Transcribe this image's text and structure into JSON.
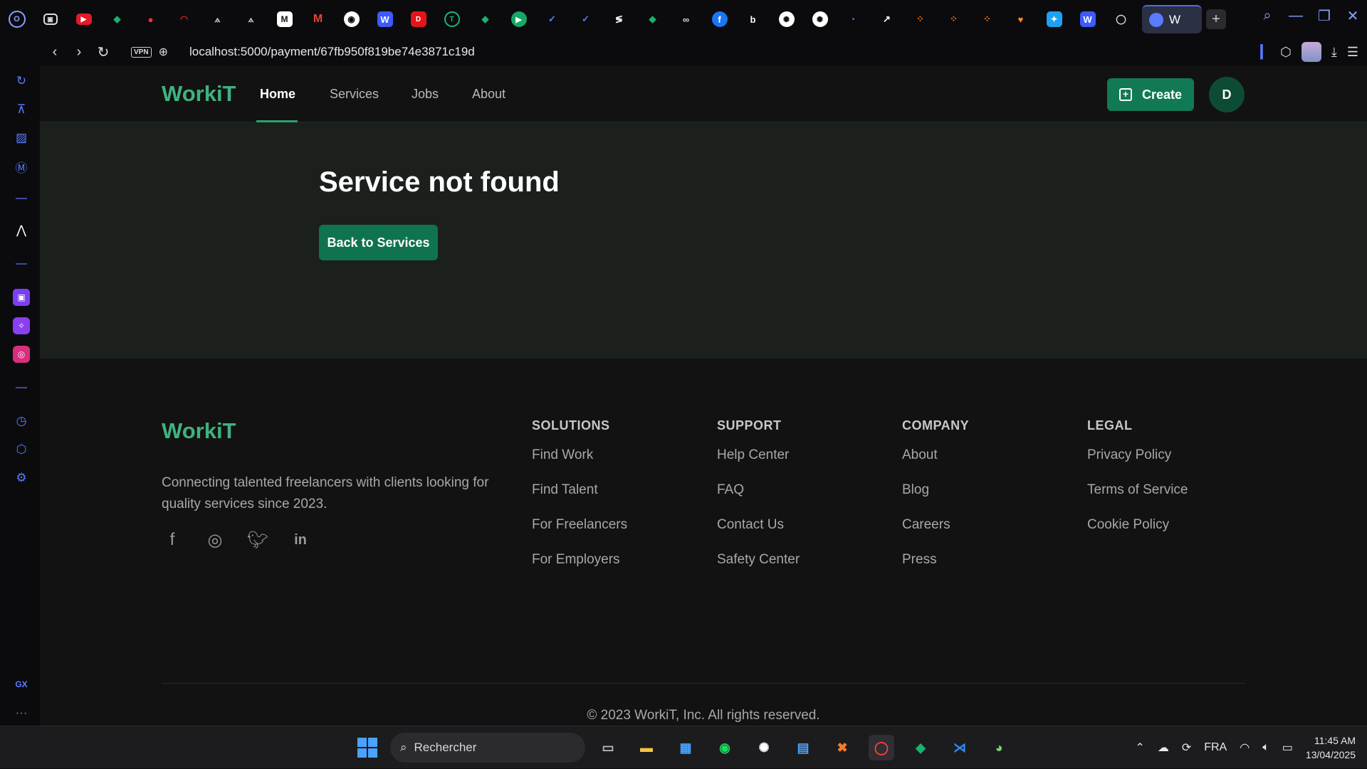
{
  "browser": {
    "tabs_icons": [
      "youtube",
      "mongodb",
      "red-app",
      "speed",
      "network",
      "network",
      "mastodon",
      "gmail",
      "github",
      "word",
      "dribbble",
      "ticktick",
      "mongodb",
      "arrow-app",
      "vk",
      "vk",
      "stack",
      "mongodb",
      "ring",
      "facebook",
      "bold",
      "chatgpt",
      "chatgpt",
      "dot",
      "arrow",
      "grid",
      "grid",
      "grid",
      "heart",
      "bluesky",
      "word",
      "circle"
    ],
    "active_tab_label": "W",
    "new_tab_label": "+",
    "url_host": "localhost",
    "url_rest": ":5000/payment/67fb950f819be74e3871c19d",
    "vpn_label": "VPN"
  },
  "site": {
    "brand": "WorkiT",
    "nav": [
      "Home",
      "Services",
      "Jobs",
      "About"
    ],
    "create_label": "Create",
    "avatar_initial": "D"
  },
  "hero": {
    "title": "Service not found",
    "back_button": "Back to Services"
  },
  "footer": {
    "brand": "WorkiT",
    "tagline": "Connecting talented freelancers with clients looking for quality services since 2023.",
    "social": [
      "facebook-icon",
      "instagram-icon",
      "twitter-icon",
      "linkedin-icon"
    ],
    "columns": [
      {
        "title": "SOLUTIONS",
        "links": [
          "Find Work",
          "Find Talent",
          "For Freelancers",
          "For Employers"
        ]
      },
      {
        "title": "SUPPORT",
        "links": [
          "Help Center",
          "FAQ",
          "Contact Us",
          "Safety Center"
        ]
      },
      {
        "title": "COMPANY",
        "links": [
          "About",
          "Blog",
          "Careers",
          "Press"
        ]
      },
      {
        "title": "LEGAL",
        "links": [
          "Privacy Policy",
          "Terms of Service",
          "Cookie Policy"
        ]
      }
    ],
    "copyright": "© 2023 WorkiT, Inc. All rights reserved."
  },
  "sidebar": {
    "gx_label": "GX",
    "more_label": "···"
  },
  "taskbar": {
    "search_placeholder": "Rechercher",
    "language": "FRA",
    "time": "11:45 AM",
    "date": "13/04/2025"
  },
  "colors": {
    "brand_green": "#3fb27f",
    "button_green": "#117a55",
    "hero_bg": "#1b201d",
    "page_bg": "#121212"
  }
}
